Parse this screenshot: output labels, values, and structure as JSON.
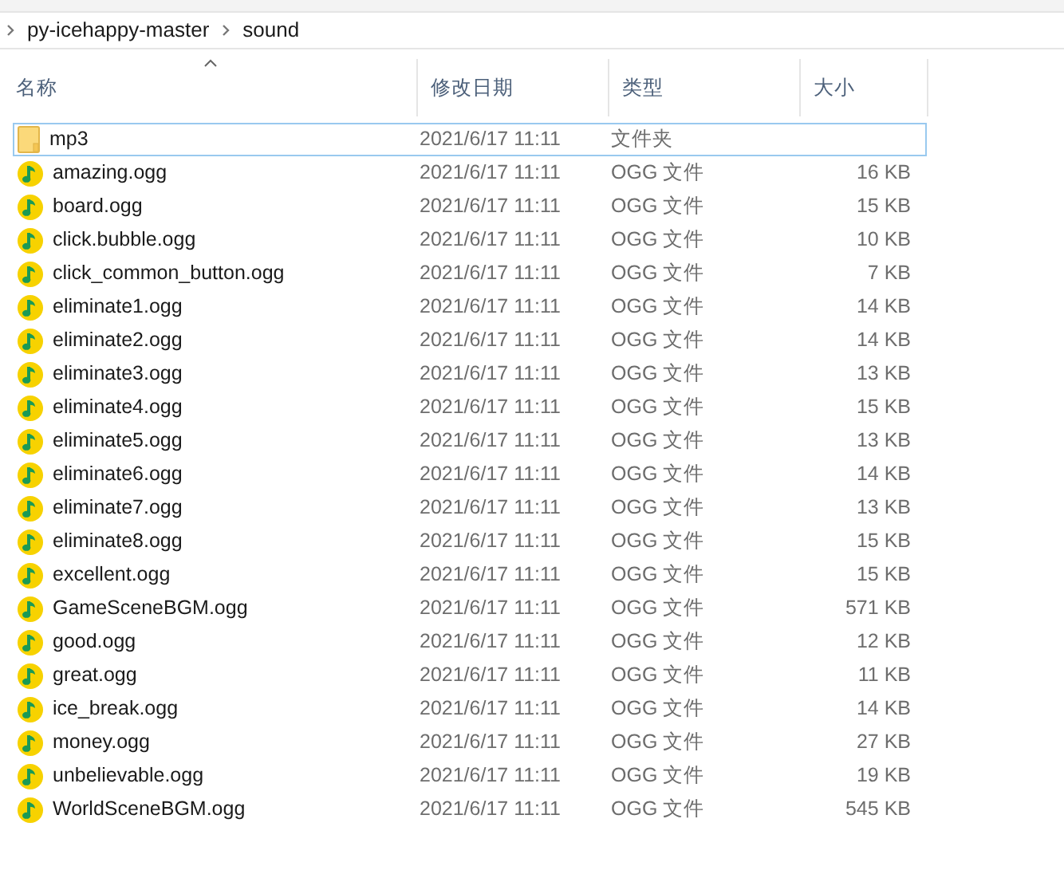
{
  "breadcrumbs": [
    {
      "label": "py-icehappy-master"
    },
    {
      "label": "sound"
    }
  ],
  "columns": [
    {
      "label": "名称",
      "sorted": true
    },
    {
      "label": "修改日期",
      "sorted": false
    },
    {
      "label": "类型",
      "sorted": false
    },
    {
      "label": "大小",
      "sorted": false
    }
  ],
  "rows": [
    {
      "kind": "folder",
      "name": "mp3",
      "date": "2021/6/17 11:11",
      "type": "文件夹",
      "size": "",
      "selected": true
    },
    {
      "kind": "audio",
      "name": "amazing.ogg",
      "date": "2021/6/17 11:11",
      "type": "OGG 文件",
      "size": "16 KB",
      "selected": false
    },
    {
      "kind": "audio",
      "name": "board.ogg",
      "date": "2021/6/17 11:11",
      "type": "OGG 文件",
      "size": "15 KB",
      "selected": false
    },
    {
      "kind": "audio",
      "name": "click.bubble.ogg",
      "date": "2021/6/17 11:11",
      "type": "OGG 文件",
      "size": "10 KB",
      "selected": false
    },
    {
      "kind": "audio",
      "name": "click_common_button.ogg",
      "date": "2021/6/17 11:11",
      "type": "OGG 文件",
      "size": "7 KB",
      "selected": false
    },
    {
      "kind": "audio",
      "name": "eliminate1.ogg",
      "date": "2021/6/17 11:11",
      "type": "OGG 文件",
      "size": "14 KB",
      "selected": false
    },
    {
      "kind": "audio",
      "name": "eliminate2.ogg",
      "date": "2021/6/17 11:11",
      "type": "OGG 文件",
      "size": "14 KB",
      "selected": false
    },
    {
      "kind": "audio",
      "name": "eliminate3.ogg",
      "date": "2021/6/17 11:11",
      "type": "OGG 文件",
      "size": "13 KB",
      "selected": false
    },
    {
      "kind": "audio",
      "name": "eliminate4.ogg",
      "date": "2021/6/17 11:11",
      "type": "OGG 文件",
      "size": "15 KB",
      "selected": false
    },
    {
      "kind": "audio",
      "name": "eliminate5.ogg",
      "date": "2021/6/17 11:11",
      "type": "OGG 文件",
      "size": "13 KB",
      "selected": false
    },
    {
      "kind": "audio",
      "name": "eliminate6.ogg",
      "date": "2021/6/17 11:11",
      "type": "OGG 文件",
      "size": "14 KB",
      "selected": false
    },
    {
      "kind": "audio",
      "name": "eliminate7.ogg",
      "date": "2021/6/17 11:11",
      "type": "OGG 文件",
      "size": "13 KB",
      "selected": false
    },
    {
      "kind": "audio",
      "name": "eliminate8.ogg",
      "date": "2021/6/17 11:11",
      "type": "OGG 文件",
      "size": "15 KB",
      "selected": false
    },
    {
      "kind": "audio",
      "name": "excellent.ogg",
      "date": "2021/6/17 11:11",
      "type": "OGG 文件",
      "size": "15 KB",
      "selected": false
    },
    {
      "kind": "audio",
      "name": "GameSceneBGM.ogg",
      "date": "2021/6/17 11:11",
      "type": "OGG 文件",
      "size": "571 KB",
      "selected": false
    },
    {
      "kind": "audio",
      "name": "good.ogg",
      "date": "2021/6/17 11:11",
      "type": "OGG 文件",
      "size": "12 KB",
      "selected": false
    },
    {
      "kind": "audio",
      "name": "great.ogg",
      "date": "2021/6/17 11:11",
      "type": "OGG 文件",
      "size": "11 KB",
      "selected": false
    },
    {
      "kind": "audio",
      "name": "ice_break.ogg",
      "date": "2021/6/17 11:11",
      "type": "OGG 文件",
      "size": "14 KB",
      "selected": false
    },
    {
      "kind": "audio",
      "name": "money.ogg",
      "date": "2021/6/17 11:11",
      "type": "OGG 文件",
      "size": "27 KB",
      "selected": false
    },
    {
      "kind": "audio",
      "name": "unbelievable.ogg",
      "date": "2021/6/17 11:11",
      "type": "OGG 文件",
      "size": "19 KB",
      "selected": false
    },
    {
      "kind": "audio",
      "name": "WorldSceneBGM.ogg",
      "date": "2021/6/17 11:11",
      "type": "OGG 文件",
      "size": "545 KB",
      "selected": false
    }
  ]
}
